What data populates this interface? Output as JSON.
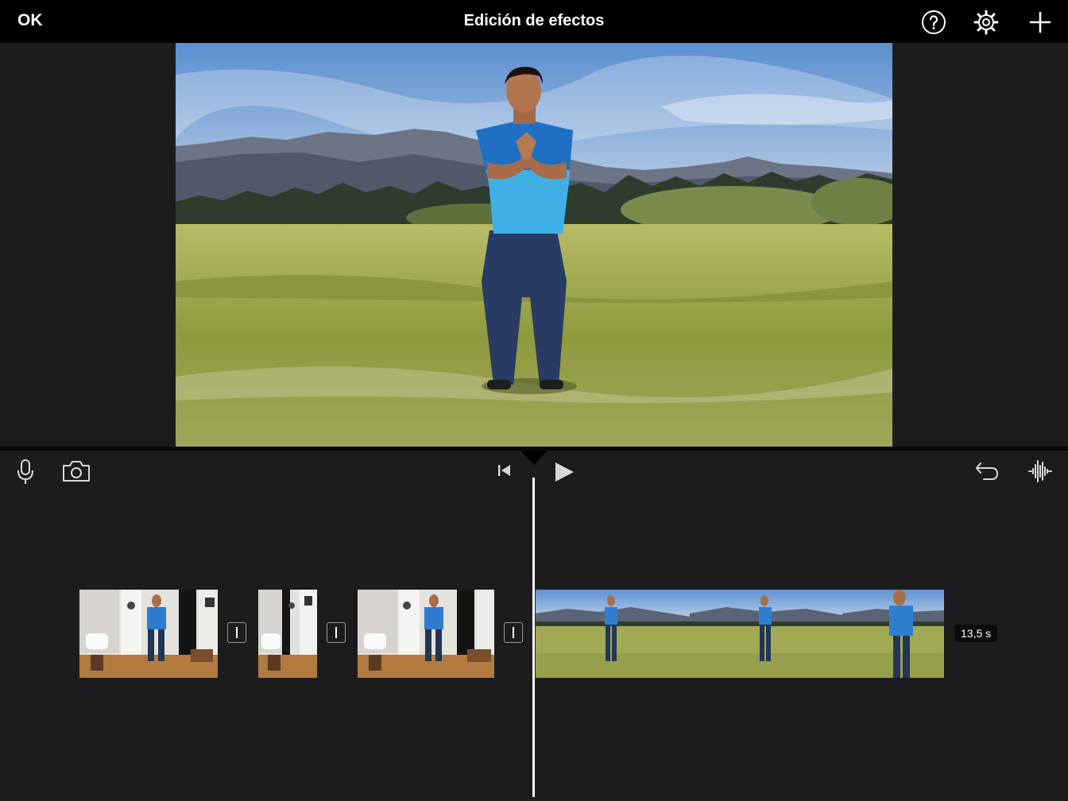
{
  "topbar": {
    "done_label": "OK",
    "title": "Edición de efectos",
    "icons": [
      "help-icon",
      "settings-gear-icon",
      "add-icon"
    ]
  },
  "viewer": {
    "content": "preview-frame"
  },
  "toolbar": {
    "left_icons": [
      "microphone-icon",
      "camera-icon"
    ],
    "center_icons": [
      "skip-to-start-icon",
      "play-icon"
    ],
    "right_icons": [
      "undo-icon",
      "audio-waveform-icon"
    ]
  },
  "timeline": {
    "clips": [
      {
        "scene": "indoor-room"
      },
      {
        "scene": "indoor-room"
      },
      {
        "scene": "indoor-room"
      },
      {
        "scene": "outdoor-meadow"
      }
    ],
    "transitions": 3,
    "duration_label": "13,5 s"
  },
  "colors": {
    "background": "#1c1c1e",
    "topbar": "#000000",
    "text": "#ffffff",
    "sky": "#7fa9d9",
    "grass": "#9ea64a",
    "shirt": "#2b78c8"
  }
}
